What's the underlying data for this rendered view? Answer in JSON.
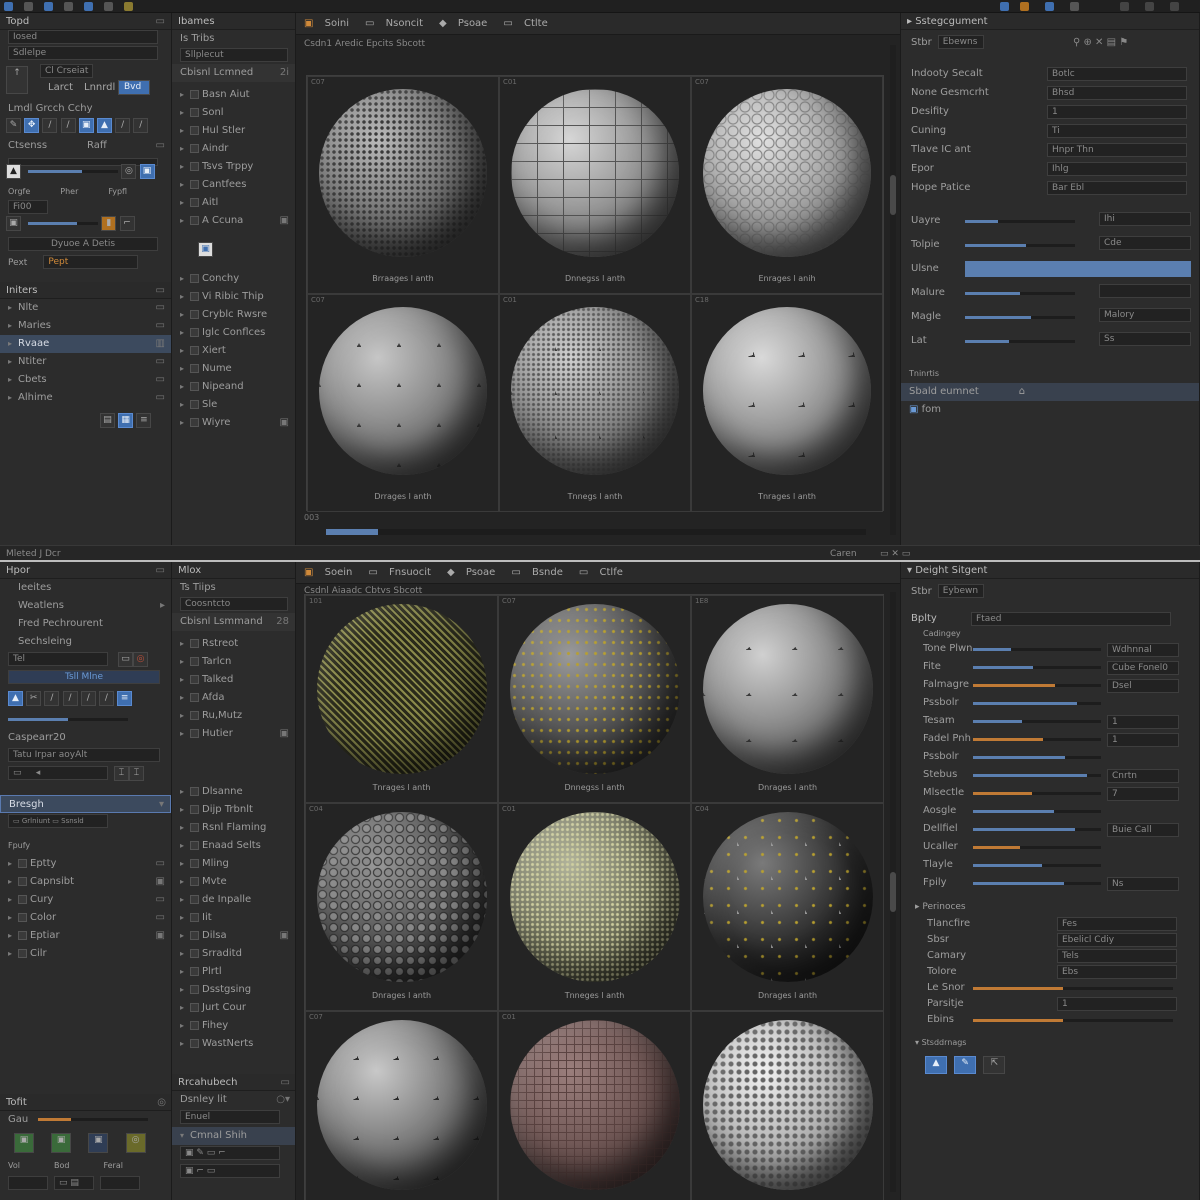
{
  "w1": {
    "left": {
      "tools_header": "Topd",
      "field1": "Cl Crseiat",
      "tab_a": "Larct",
      "tab_b": "Lnnrdl",
      "tool_row": "Lmdl Grcch Cchy",
      "sec2": "Ctsenss",
      "sec2_b": "Raff",
      "row_a1": "Orgfe",
      "row_a2": "Pher",
      "row_a3": "Fypfl",
      "row_a4": "Fi00",
      "dropdown": "Dyuoe A Detis",
      "pext_label": "Pext",
      "pext_value": "Pept",
      "list_header": "Initers",
      "items": [
        {
          "label": "Nlte"
        },
        {
          "label": "Maries"
        },
        {
          "label": "Rvaae"
        },
        {
          "label": "Ntiter"
        },
        {
          "label": "Cbets"
        },
        {
          "label": "Alhime"
        }
      ]
    },
    "tree": {
      "header": "Ibames",
      "sub": "Is Tribs",
      "sub2": "Sllplecut",
      "mode": "Cbisnl Lcmned",
      "mode_num": "2i",
      "items1": [
        {
          "label": "Basn Aiut"
        },
        {
          "label": "Sonl"
        },
        {
          "label": "Hul Stler"
        },
        {
          "label": "Aindr"
        },
        {
          "label": "Tsvs Trppy"
        },
        {
          "label": "Cantfees"
        },
        {
          "label": "Aitl"
        },
        {
          "label": "A Ccuna"
        }
      ],
      "items2": [
        {
          "label": "Conchy"
        },
        {
          "label": "Vi Ribic Thip"
        },
        {
          "label": "Cryblc Rwsre"
        },
        {
          "label": "Iglc Conflces"
        },
        {
          "label": "Xiert"
        },
        {
          "label": "Nume"
        },
        {
          "label": "Nipeand"
        },
        {
          "label": "Sle"
        },
        {
          "label": "Wiyre"
        }
      ]
    },
    "viewport": {
      "toolbar": [
        "Soini",
        "Nsoncit",
        "Psoae",
        "Ctlte"
      ],
      "title": "Csdn1 Aredic Epcits Sbcott",
      "cells": [
        {
          "idx": "C07",
          "label": "Brraages l anth"
        },
        {
          "idx": "C01",
          "label": "Dnnegss l anth"
        },
        {
          "idx": "C07",
          "label": "Enrages l anih"
        },
        {
          "idx": "C07",
          "label": "Drrages l anth"
        },
        {
          "idx": "C01",
          "label": "Tnnegs l anth"
        },
        {
          "idx": "C18",
          "label": "Tnrages l anth"
        }
      ],
      "status_left": "003"
    },
    "props": {
      "header": "Sstegcgument",
      "filter_label": "Stbr",
      "filter_value": "Ebewns",
      "rows": [
        {
          "label": "Indooty Secalt",
          "value": "Botlc"
        },
        {
          "label": "None Gesmcrht",
          "value": "Bhsd"
        },
        {
          "label": "Desifity",
          "value": "1"
        },
        {
          "label": "Cuning",
          "value": "Ti"
        },
        {
          "label": "Tlave IC ant",
          "value": "Hnpr Thn"
        },
        {
          "label": "Epor",
          "value": "Ihlg"
        },
        {
          "label": "Hope Patice",
          "value": "Bar Ebl"
        }
      ],
      "s2": [
        {
          "label": "Uayre",
          "value": "Ihi",
          "pct": 0.3
        },
        {
          "label": "Tolpie",
          "value": "Cde",
          "pct": 0.55
        },
        {
          "label": "Ulsne",
          "value": "",
          "pct": 1.0
        },
        {
          "label": "Malure",
          "value": "",
          "pct": 0.5
        },
        {
          "label": "Magle",
          "value": "Malory",
          "pct": 0.6
        },
        {
          "label": "Lat",
          "value": "Ss",
          "pct": 0.4
        }
      ],
      "s3": "Tninrtis",
      "s3_row": "Sbald eumnet",
      "s3_row2": "fom"
    }
  },
  "divider": {
    "left": "Mleted J Dcr",
    "right": "Caren"
  },
  "w2": {
    "left": {
      "header": "Hpor",
      "items": [
        {
          "label": "Ieeites"
        },
        {
          "label": "Weatlens"
        },
        {
          "label": "Fred Pechrourent"
        },
        {
          "label": "Sechsleing"
        }
      ],
      "field_a": "Tel",
      "field_b": "Tsll Mlne",
      "field_c": "Caspearr20",
      "field_d": "Tatu Irpar aoyAlt",
      "highlight": "Bresgh",
      "sub": "Fpufy",
      "list": [
        {
          "label": "Eptty"
        },
        {
          "label": "Capnsibt"
        },
        {
          "label": "Cury"
        },
        {
          "label": "Color"
        },
        {
          "label": "Eptiar"
        },
        {
          "label": "Cilr"
        }
      ],
      "bottom_header": "Tofit",
      "bottom_sub": "Gau",
      "bottom_labels": [
        "Vol",
        "Bod",
        "Feral"
      ]
    },
    "tree": {
      "header": "Mlox",
      "sub": "Ts Tiips",
      "sub2": "Coosntcto",
      "mode": "Cbisnl Lsmmand",
      "mode_num": "28",
      "items1": [
        {
          "label": "Rstreot"
        },
        {
          "label": "Tarlcn"
        },
        {
          "label": "Talked"
        },
        {
          "label": "Afda"
        },
        {
          "label": "Ru,Mutz"
        },
        {
          "label": "Hutier"
        }
      ],
      "items2": [
        {
          "label": "Dlsanne"
        },
        {
          "label": "Dijp Trbnlt"
        },
        {
          "label": "Rsnl Flaming"
        },
        {
          "label": "Enaad Selts"
        },
        {
          "label": "Mling"
        },
        {
          "label": "Mvte"
        },
        {
          "label": "de Inpalle"
        },
        {
          "label": "Iit"
        },
        {
          "label": "Dilsa"
        },
        {
          "label": "Srraditd"
        },
        {
          "label": "Plrtl"
        },
        {
          "label": "Dsstgsing"
        },
        {
          "label": "Jurt Cour"
        },
        {
          "label": "Fihey"
        },
        {
          "label": "WastNerts"
        }
      ],
      "bottom_header": "Rrcahubech",
      "bottom_sub": "Dsnley lit",
      "bottom_sub2": "Enuel",
      "bottom_sub3": "Cmnal Shih"
    },
    "viewport": {
      "toolbar": [
        "Soein",
        "Fnsuocit",
        "Psoae",
        "Bsnde",
        "Ctlfe"
      ],
      "title": "Csdnl Aiaadc Cbtvs Sbcott",
      "cells": [
        {
          "idx": "101",
          "label": "Tnrages l anth"
        },
        {
          "idx": "C07",
          "label": "Dnnegss l anth"
        },
        {
          "idx": "1E8",
          "label": "Dnrages l anth"
        },
        {
          "idx": "C04",
          "label": "Dnrages l anth"
        },
        {
          "idx": "C01",
          "label": "Tnneges l anth"
        },
        {
          "idx": "C04",
          "label": "Dnrages l anth"
        },
        {
          "idx": "C07",
          "label": ""
        },
        {
          "idx": "C01",
          "label": ""
        },
        {
          "idx": "",
          "label": ""
        }
      ]
    },
    "props": {
      "header": "Deight Sitgent",
      "filter_label": "Stbr",
      "filter_value": "Eybewn",
      "p1_label": "Bplty",
      "p1_value": "Ftaed",
      "group": "Cadingey",
      "rows": [
        {
          "label": "Tone Plwn",
          "value": "Wdhnnal"
        },
        {
          "label": "Fite",
          "value": "Cube Fonel0"
        },
        {
          "label": "Falmagre",
          "value": "Dsel"
        },
        {
          "label": "Pssbolr",
          "value": ""
        },
        {
          "label": "Tesam",
          "value": "1"
        },
        {
          "label": "Fadel Pnh",
          "value": "1"
        },
        {
          "label": "Pssbolr",
          "value": ""
        },
        {
          "label": "Stebus",
          "value": "Cnrtn"
        },
        {
          "label": "Mlsectle",
          "value": "7"
        },
        {
          "label": "Aosgle",
          "value": ""
        },
        {
          "label": "Dellfiel",
          "value": "Buie Call"
        },
        {
          "label": "Ucaller",
          "value": ""
        },
        {
          "label": "Tlayle",
          "value": ""
        },
        {
          "label": "Fpily",
          "value": "Ns"
        }
      ],
      "s2": "Perinoces",
      "s2_rows": [
        {
          "label": "Tlancfire",
          "value": "Fes"
        },
        {
          "label": "Sbsr",
          "value": "Ebelicl Cdiy"
        },
        {
          "label": "Camary",
          "value": "Tels"
        },
        {
          "label": "Tolore",
          "value": "Ebs"
        },
        {
          "label": "Le Snor",
          "value": ""
        },
        {
          "label": "Parsitje",
          "value": "1"
        },
        {
          "label": "Ebins",
          "value": ""
        }
      ],
      "s3": "Stsddrnags"
    }
  }
}
